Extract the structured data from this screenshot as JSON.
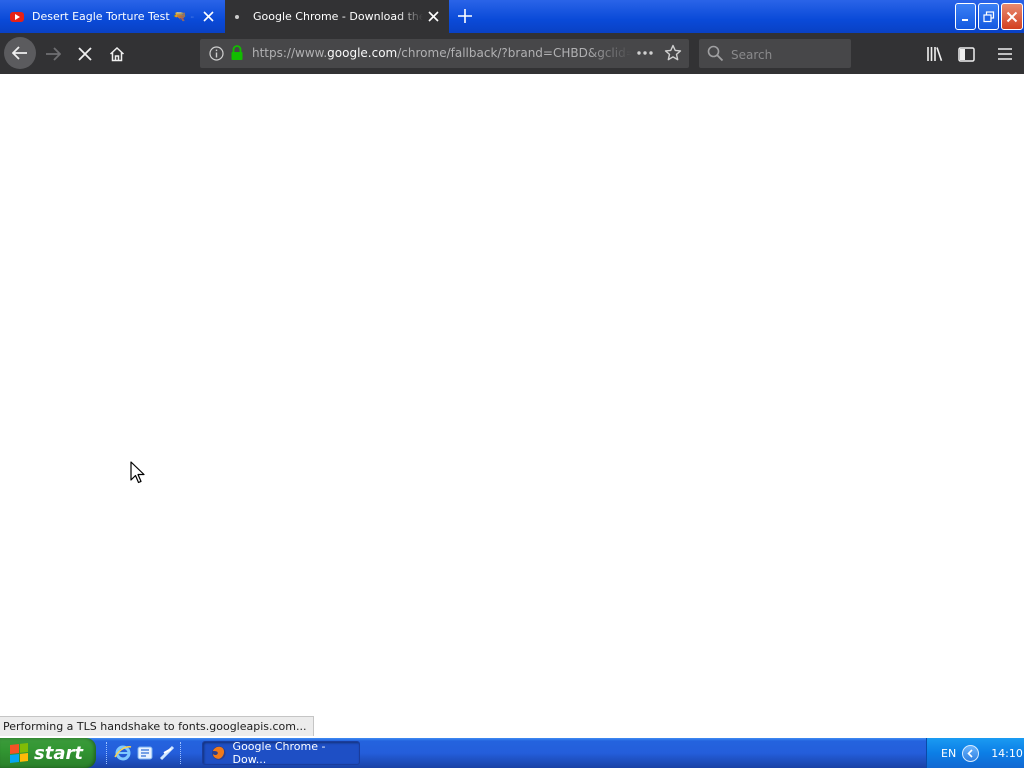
{
  "tabs": [
    {
      "title": "Desert Eagle Torture Test 🔫 - YouTube",
      "icon": "youtube-icon",
      "active": false
    },
    {
      "title": "Google Chrome - Download the Fast, Secure Browser from Google",
      "icon": "loading-dot-icon",
      "active": true
    }
  ],
  "url": {
    "prefix": "https://www.",
    "domain": "google.com",
    "path": "/chrome/fallback/?brand=CHBD&gclid=EAIaIQobChMI"
  },
  "search": {
    "placeholder": "Search"
  },
  "status_text": "Performing a TLS handshake to fonts.googleapis.com...",
  "taskbar": {
    "start_label": "start",
    "task_button_label": "Google Chrome - Dow...",
    "language": "EN",
    "clock": "14:10"
  },
  "colors": {
    "titlebar_blue": "#0a4ad8",
    "toolbar_dark": "#323234",
    "urlbar_bg": "#474749",
    "lock_green": "#12bc00",
    "start_green": "#329632",
    "taskbar_blue": "#245edb"
  }
}
